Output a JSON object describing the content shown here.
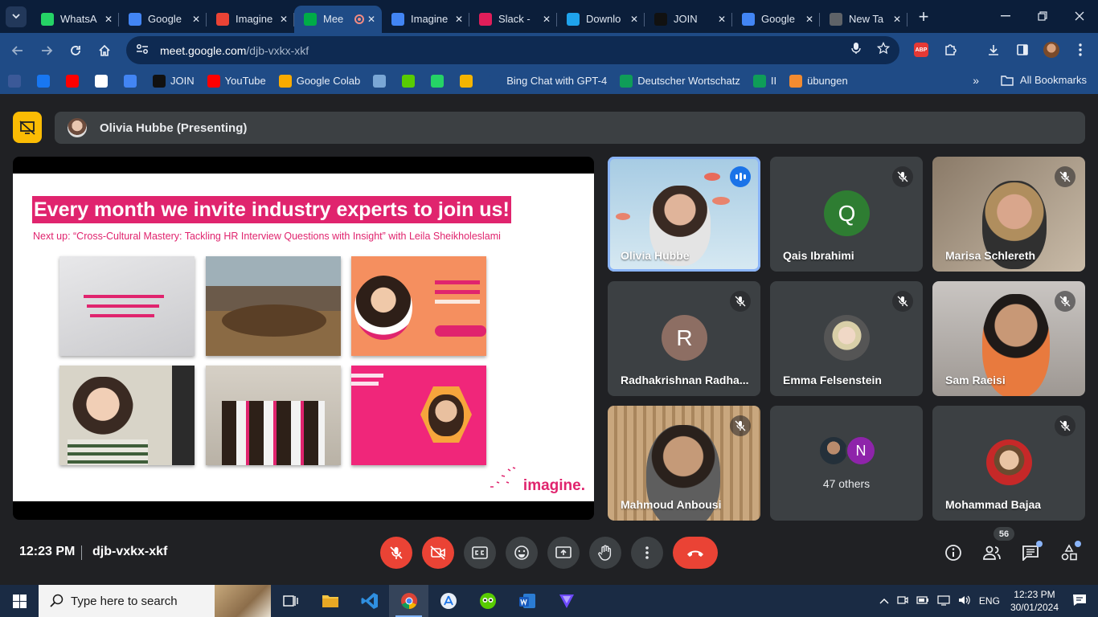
{
  "browser": {
    "tabs": [
      {
        "title": "WhatsA",
        "icon": "whatsapp-icon",
        "color": "#25d366"
      },
      {
        "title": "Google",
        "icon": "google-translate-icon",
        "color": "#4285f4"
      },
      {
        "title": "Imagine",
        "icon": "gmail-icon",
        "color": "#ea4335"
      },
      {
        "title": "Mee",
        "icon": "google-meet-icon",
        "color": "#00ac47",
        "active": true
      },
      {
        "title": "Imagine",
        "icon": "google-docs-icon",
        "color": "#4285f4"
      },
      {
        "title": "Slack - ",
        "icon": "slack-icon",
        "color": "#e01e5a"
      },
      {
        "title": "Downlo",
        "icon": "download-site-icon",
        "color": "#1fa3ec"
      },
      {
        "title": "JOIN",
        "icon": "join-icon",
        "color": "#111111"
      },
      {
        "title": "Google",
        "icon": "google-translate-icon",
        "color": "#4285f4"
      },
      {
        "title": "New Ta",
        "icon": "chrome-icon",
        "color": "#5f6368"
      }
    ],
    "url_host": "meet.google.com",
    "url_path": "/djb-vxkx-xkf",
    "bookmarks": [
      {
        "label": "",
        "icon": "extension-icon",
        "color": "#3b5998"
      },
      {
        "label": "",
        "icon": "facebook-icon",
        "color": "#1877f2"
      },
      {
        "label": "",
        "icon": "youtube-icon",
        "color": "#ff0000"
      },
      {
        "label": "",
        "icon": "google-icon",
        "color": "#ffffff"
      },
      {
        "label": "",
        "icon": "google-translate-icon",
        "color": "#4285f4"
      },
      {
        "label": "JOIN",
        "icon": "join-icon",
        "color": "#111111"
      },
      {
        "label": "YouTube",
        "icon": "youtube-icon",
        "color": "#ff0000"
      },
      {
        "label": "Google Colab",
        "icon": "colab-icon",
        "color": "#f9ab00"
      },
      {
        "label": "",
        "icon": "image-icon",
        "color": "#7aa7d6"
      },
      {
        "label": "",
        "icon": "duolingo-icon",
        "color": "#58cc02"
      },
      {
        "label": "",
        "icon": "whatsapp-icon",
        "color": "#25d366"
      },
      {
        "label": "",
        "icon": "five-icon",
        "color": "#f4b400"
      },
      {
        "label": "Bing Chat with GPT-4",
        "icon": "bing-icon",
        "color": "#1f4b86"
      },
      {
        "label": "Deutscher Wortschatz",
        "icon": "sheets-icon",
        "color": "#0f9d58"
      },
      {
        "label": "II",
        "icon": "sheets-icon",
        "color": "#0f9d58"
      },
      {
        "label": "übungen",
        "icon": "brush-icon",
        "color": "#f28b30"
      }
    ],
    "more_label": "»",
    "all_bookmarks": "All Bookmarks",
    "abp_label": "ABP"
  },
  "meet": {
    "presenter": "Olivia Hubbe (Presenting)",
    "slide": {
      "title": "Every month we invite industry experts to join us!",
      "subtitle": "Next up: “Cross-Cultural Mastery: Tackling HR Interview Questions with Insight” with Leila Sheikholeslami",
      "logo": "imagine."
    },
    "tiles": [
      {
        "name": "Olivia Hubbe",
        "speaking": true
      },
      {
        "name": "Qais Ibrahimi",
        "letter": "Q",
        "letter_color": "#2e7d32",
        "muted": true
      },
      {
        "name": "Marisa Schlereth",
        "muted": true
      },
      {
        "name": "Radhakrishnan Radha...",
        "letter": "R",
        "letter_color": "#8d6e63",
        "muted": true
      },
      {
        "name": "Emma Felsenstein",
        "muted": true
      },
      {
        "name": "Sam Raeisi",
        "muted": true
      },
      {
        "name": "Mahmoud Anbousi",
        "muted": true
      },
      {
        "name": "47 others",
        "letter": "N",
        "letter_color": "#8e24aa"
      },
      {
        "name": "Mohammad Bajaa",
        "muted": true
      }
    ],
    "time": "12:23 PM",
    "meeting_code": "djb-vxkx-xkf",
    "participant_count": "56"
  },
  "taskbar": {
    "search_placeholder": "Type here to search",
    "language": "ENG",
    "time": "12:23 PM",
    "date": "30/01/2024"
  }
}
